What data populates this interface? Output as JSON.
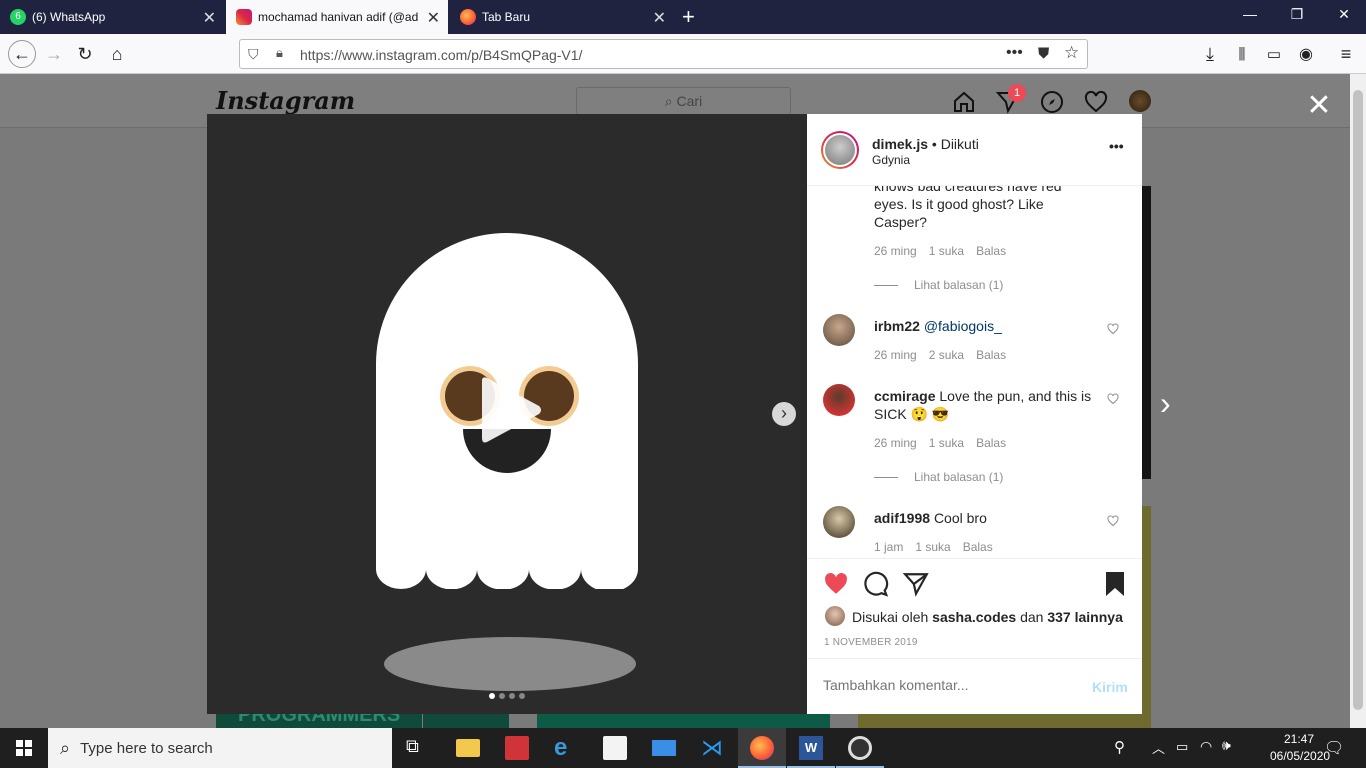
{
  "browser": {
    "tabs": [
      {
        "label": "(6) WhatsApp",
        "icon": "whatsapp-icon"
      },
      {
        "label": "mochamad hanivan adif (@adi",
        "icon": "instagram-icon"
      },
      {
        "label": "Tab Baru",
        "icon": "firefox-icon"
      }
    ],
    "url": "https://www.instagram.com/p/B4SmQPag-V1/"
  },
  "instagram": {
    "logo": "Instagram",
    "search_placeholder": "Cari",
    "dm_badge": "1",
    "post": {
      "author": "dimek.js",
      "follow_status": "• Diikuti",
      "location": "Gdynia",
      "first_comment_text": "knows bad creatures have red eyes. Is it good ghost? Like Casper?",
      "first_comment_meta": [
        "26 ming",
        "1 suka",
        "Balas"
      ],
      "view_replies": "Lihat balasan (1)",
      "comments": [
        {
          "user": "irbm22",
          "text": "@fabiogois_",
          "time": "26 ming",
          "likes": "2 suka",
          "reply": "Balas"
        },
        {
          "user": "ccmirage",
          "text": "Love the pun, and this is SICK 😲 😎",
          "time": "26 ming",
          "likes": "1 suka",
          "reply": "Balas",
          "replies": "Lihat balasan (1)"
        },
        {
          "user": "adif1998",
          "text": "Cool bro",
          "time": "1 jam",
          "likes": "1 suka",
          "reply": "Balas"
        }
      ],
      "liked_by_prefix": "Disukai oleh",
      "liked_by_user": "sasha.codes",
      "liked_by_and": "dan",
      "liked_by_others": "337 lainnya",
      "date": "1 NOVEMBER 2019",
      "comment_placeholder": "Tambahkan komentar...",
      "send_label": "Kirim"
    },
    "below_card_text": "PROGRAMMERS"
  },
  "taskbar": {
    "search_placeholder": "Type here to search",
    "time": "21:47",
    "date": "06/05/2020"
  },
  "colors": {
    "like_red": "#ed4956",
    "link_blue": "#0095f6",
    "tabbar": "#202340"
  }
}
